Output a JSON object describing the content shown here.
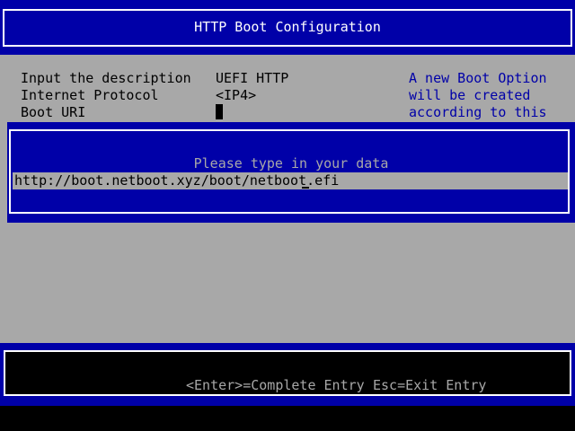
{
  "header": {
    "title": "HTTP Boot Configuration"
  },
  "form": {
    "description_label": "Input the description",
    "description_value": "UEFI HTTP",
    "protocol_label": "Internet Protocol",
    "protocol_value": "<IP4>",
    "boot_uri_label": "Boot URI"
  },
  "help": {
    "line1": "A new Boot Option",
    "line2": "will be created",
    "line3": "according to this"
  },
  "popup": {
    "prompt": "Please type in your data",
    "input_value": "http://boot.netboot.xyz/boot/netboot.efi"
  },
  "footer": {
    "enter_hint": "<Enter>=Complete Entry",
    "esc_hint": "Esc=Exit Entry"
  },
  "colors": {
    "blue": "#0000a8",
    "grey": "#a8a8a8",
    "white": "#ffffff",
    "black": "#000000"
  }
}
